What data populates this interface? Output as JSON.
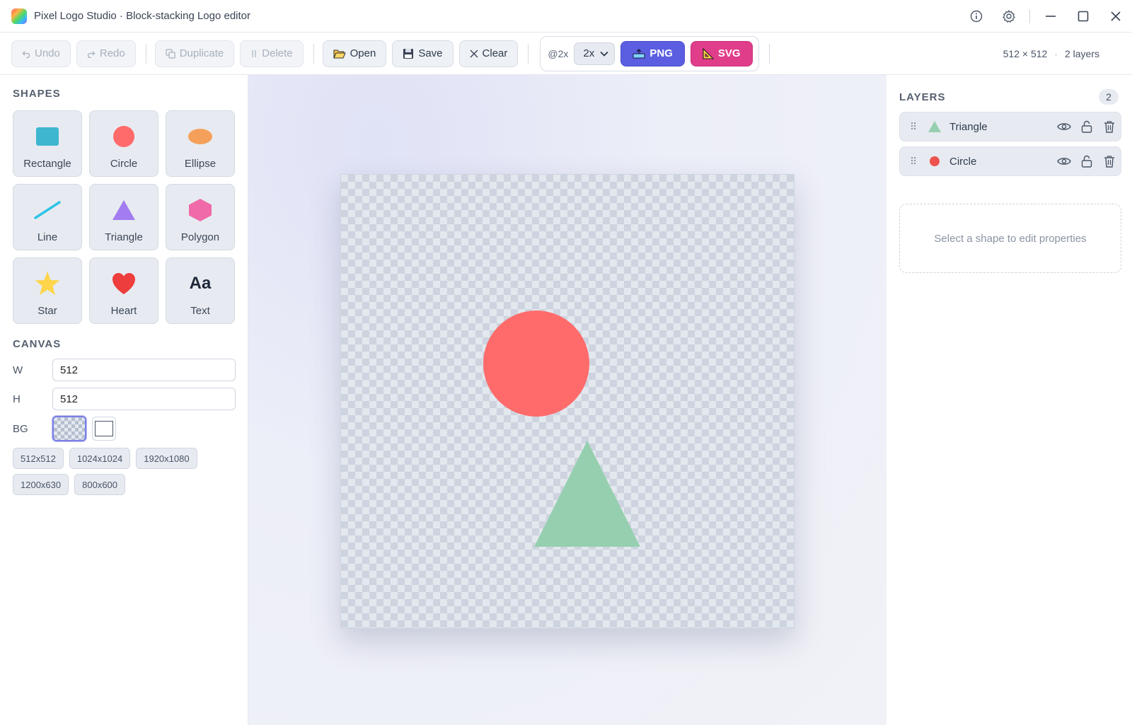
{
  "window": {
    "title": "Pixel Logo Studio · Block-stacking Logo editor"
  },
  "toolbar": {
    "undo_label": "Undo",
    "redo_label": "Redo",
    "duplicate_label": "Duplicate",
    "delete_label": "Delete",
    "open_label": "Open",
    "save_label": "Save",
    "clear_label": "Clear",
    "scale_label": "@2x",
    "scale_value": "2x",
    "png_label": "PNG",
    "svg_label": "SVG",
    "canvas_size": "512 × 512",
    "separator": "·",
    "layer_count_text": "2 layers"
  },
  "shapes": {
    "heading": "SHAPES",
    "items": [
      {
        "label": "Rectangle",
        "icon": "rectangle-icon",
        "color": "#3fb6cf"
      },
      {
        "label": "Circle",
        "icon": "circle-icon",
        "color": "#ff6b6b"
      },
      {
        "label": "Ellipse",
        "icon": "ellipse-icon",
        "color": "#f5a05a"
      },
      {
        "label": "Line",
        "icon": "line-icon",
        "color": "#2ec4e6"
      },
      {
        "label": "Triangle",
        "icon": "triangle-icon",
        "color": "#a27cf0"
      },
      {
        "label": "Polygon",
        "icon": "polygon-icon",
        "color": "#f06aa9"
      },
      {
        "label": "Star",
        "icon": "star-icon",
        "color": "#ffd54a"
      },
      {
        "label": "Heart",
        "icon": "heart-icon",
        "color": "#ee3d3d"
      },
      {
        "label": "Text",
        "icon": "text-icon",
        "glyph": "Aa",
        "color": "#1f2838"
      }
    ]
  },
  "canvas": {
    "heading": "CANVAS",
    "width_label": "W",
    "width_value": "512",
    "height_label": "H",
    "height_value": "512",
    "bg_label": "BG",
    "presets_row1": [
      "512x512",
      "1024x1024",
      "1920x1080"
    ],
    "presets_row2": [
      "1200x630",
      "800x600"
    ]
  },
  "artboard": {
    "circle_color": "#ff6b6b",
    "triangle_color": "#96cfb0"
  },
  "layers": {
    "heading": "LAYERS",
    "count": "2",
    "items": [
      {
        "name": "Triangle",
        "icon": "triangle-icon",
        "color": "#96cfb0"
      },
      {
        "name": "Circle",
        "icon": "circle-icon",
        "color": "#ef5350"
      }
    ],
    "empty_properties": "Select a shape to edit properties"
  }
}
